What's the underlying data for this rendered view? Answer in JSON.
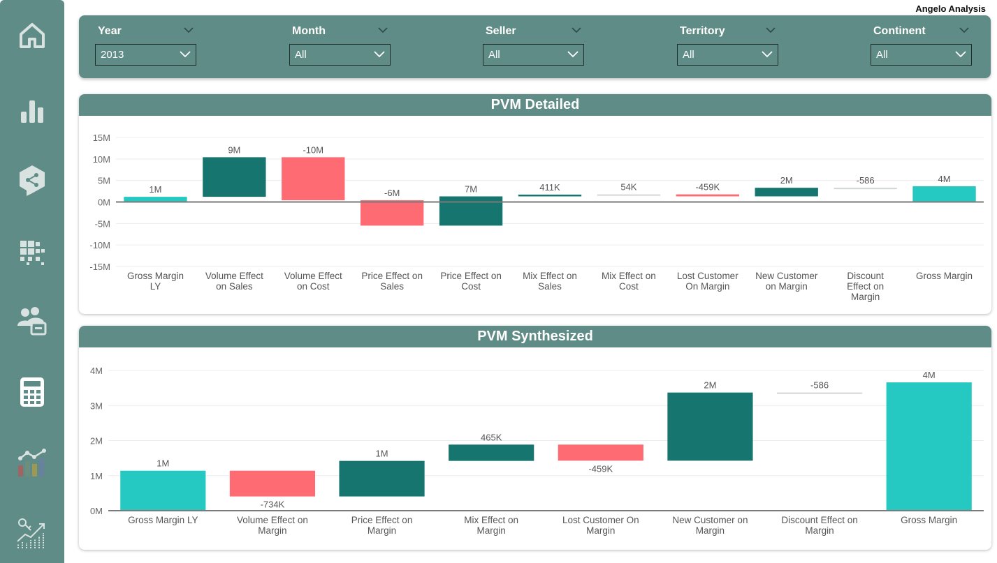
{
  "brand": "Angelo Analysis",
  "nav": [
    {
      "icon": "home-icon"
    },
    {
      "icon": "bar-chart-icon"
    },
    {
      "icon": "share-hexagon-icon"
    },
    {
      "icon": "grid-icon"
    },
    {
      "icon": "users-icon"
    },
    {
      "icon": "calculator-icon",
      "active": true
    },
    {
      "icon": "line-bar-chart-icon"
    },
    {
      "icon": "key-growth-chart-icon"
    }
  ],
  "filters": [
    {
      "label": "Year",
      "value": "2013"
    },
    {
      "label": "Month",
      "value": "All"
    },
    {
      "label": "Seller",
      "value": "All"
    },
    {
      "label": "Territory",
      "value": "All"
    },
    {
      "label": "Continent",
      "value": "All"
    }
  ],
  "colors": {
    "panel": "#5f8c86",
    "total": "#26c9c1",
    "increase": "#16756f",
    "decrease": "#fe6b73",
    "neutral": "#d3d6d6"
  },
  "chart_data": [
    {
      "type": "bar",
      "subtype": "waterfall",
      "title": "PVM Detailed",
      "ylim": [
        -15000000,
        15000000
      ],
      "yticks": [
        -15000000,
        -10000000,
        -5000000,
        0,
        5000000,
        10000000,
        15000000
      ],
      "ytick_labels": [
        "-15M",
        "-10M",
        "-5M",
        "0M",
        "5M",
        "10M",
        "15M"
      ],
      "grid": true,
      "categories": [
        "Gross Margin LY",
        "Volume Effect on Sales",
        "Volume Effect on Cost",
        "Price Effect on Sales",
        "Price Effect on Cost",
        "Mix Effect on Sales",
        "Mix Effect on Cost",
        "Lost Customer On Margin",
        "New Customer on Margin",
        "Discount Effect on Margin",
        "Gross Margin"
      ],
      "category_lines": [
        [
          "Gross Margin",
          "LY"
        ],
        [
          "Volume Effect",
          "on Sales"
        ],
        [
          "Volume Effect",
          "on Cost"
        ],
        [
          "Price Effect on",
          "Sales"
        ],
        [
          "Price Effect on",
          "Cost"
        ],
        [
          "Mix Effect on",
          "Sales"
        ],
        [
          "Mix Effect on",
          "Cost"
        ],
        [
          "Lost Customer",
          "On Margin"
        ],
        [
          "New Customer",
          "on Margin"
        ],
        [
          "Discount",
          "Effect on",
          "Margin"
        ],
        [
          "Gross Margin"
        ]
      ],
      "bars": [
        {
          "start": 0,
          "end": 1200000,
          "kind": "total",
          "label": "1M"
        },
        {
          "start": 1200000,
          "end": 10400000,
          "kind": "increase",
          "label": "9M"
        },
        {
          "start": 10400000,
          "end": 400000,
          "kind": "decrease",
          "label": "-10M"
        },
        {
          "start": 400000,
          "end": -5500000,
          "kind": "decrease",
          "label": "-6M"
        },
        {
          "start": -5500000,
          "end": 1300000,
          "kind": "increase",
          "label": "7M"
        },
        {
          "start": 1300000,
          "end": 1711000,
          "kind": "increase",
          "label": "411K"
        },
        {
          "start": 1711000,
          "end": 1765000,
          "kind": "neutral",
          "label": "54K"
        },
        {
          "start": 1765000,
          "end": 1306000,
          "kind": "decrease",
          "label": "-459K"
        },
        {
          "start": 1306000,
          "end": 3300000,
          "kind": "increase",
          "label": "2M"
        },
        {
          "start": 3300000,
          "end": 3299414,
          "kind": "neutral",
          "label": "-586"
        },
        {
          "start": 0,
          "end": 3650000,
          "kind": "total",
          "label": "4M"
        }
      ]
    },
    {
      "type": "bar",
      "subtype": "waterfall",
      "title": "PVM Synthesized",
      "ylim": [
        0,
        4000000
      ],
      "yticks": [
        0,
        1000000,
        2000000,
        3000000,
        4000000
      ],
      "ytick_labels": [
        "0M",
        "1M",
        "2M",
        "3M",
        "4M"
      ],
      "grid": true,
      "categories": [
        "Gross Margin LY",
        "Volume Effect on Margin",
        "Price Effect on Margin",
        "Mix Effect on Margin",
        "Lost Customer On Margin",
        "New Customer on Margin",
        "Discount Effect on Margin",
        "Gross Margin"
      ],
      "category_lines": [
        [
          "Gross Margin LY"
        ],
        [
          "Volume Effect on",
          "Margin"
        ],
        [
          "Price Effect on",
          "Margin"
        ],
        [
          "Mix Effect on",
          "Margin"
        ],
        [
          "Lost Customer On",
          "Margin"
        ],
        [
          "New Customer on",
          "Margin"
        ],
        [
          "Discount Effect on",
          "Margin"
        ],
        [
          "Gross Margin"
        ]
      ],
      "bars": [
        {
          "start": 0,
          "end": 1140000,
          "kind": "total",
          "label": "1M"
        },
        {
          "start": 1140000,
          "end": 406000,
          "kind": "decrease",
          "label": "-734K"
        },
        {
          "start": 406000,
          "end": 1420000,
          "kind": "increase",
          "label": "1M"
        },
        {
          "start": 1420000,
          "end": 1885000,
          "kind": "increase",
          "label": "465K"
        },
        {
          "start": 1885000,
          "end": 1426000,
          "kind": "decrease",
          "label": "-459K"
        },
        {
          "start": 1426000,
          "end": 3370000,
          "kind": "increase",
          "label": "2M"
        },
        {
          "start": 3370000,
          "end": 3369414,
          "kind": "neutral",
          "label": "-586"
        },
        {
          "start": 0,
          "end": 3660000,
          "kind": "total",
          "label": "4M"
        }
      ]
    }
  ]
}
